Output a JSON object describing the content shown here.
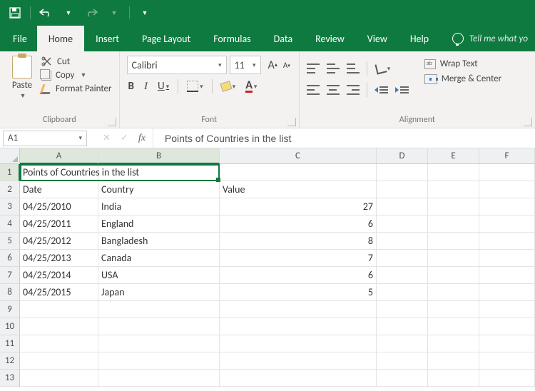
{
  "titlebar": {
    "save": "save-icon",
    "undo": "undo-icon",
    "redo": "redo-icon"
  },
  "tabs": {
    "file": "File",
    "items": [
      "Home",
      "Insert",
      "Page Layout",
      "Formulas",
      "Data",
      "Review",
      "View",
      "Help"
    ],
    "active_index": 0,
    "tell_me": "Tell me what yo"
  },
  "ribbon": {
    "clipboard": {
      "paste": "Paste",
      "cut": "Cut",
      "copy": "Copy",
      "format_painter": "Format Painter",
      "group_label": "Clipboard"
    },
    "font": {
      "name": "Calibri",
      "size": "11",
      "increase": "A",
      "decrease": "A",
      "bold": "B",
      "italic": "I",
      "underline": "U",
      "fontcolor_letter": "A",
      "group_label": "Font"
    },
    "alignment": {
      "wrap": "Wrap Text",
      "merge": "Merge & Center",
      "group_label": "Alignment"
    }
  },
  "fxbar": {
    "name_box": "A1",
    "cancel": "✕",
    "enter": "✓",
    "fx": "fx",
    "formula": "Points of Countries in the list"
  },
  "grid": {
    "columns": [
      "A",
      "B",
      "C",
      "D",
      "E",
      "F"
    ],
    "rows": [
      "1",
      "2",
      "3",
      "4",
      "5",
      "6",
      "7",
      "8",
      "9",
      "10",
      "11",
      "12",
      "13"
    ],
    "selection": {
      "col": "A",
      "row": "1"
    },
    "data": {
      "r1": {
        "A": "Points of Countries in the list"
      },
      "r2": {
        "A": "Date",
        "B": "Country",
        "C": "Value"
      },
      "r3": {
        "A": "04/25/2010",
        "B": "India",
        "C": "27"
      },
      "r4": {
        "A": "04/25/2011",
        "B": "England",
        "C": "6"
      },
      "r5": {
        "A": "04/25/2012",
        "B": "Bangladesh",
        "C": "8"
      },
      "r6": {
        "A": "04/25/2013",
        "B": "Canada",
        "C": "7"
      },
      "r7": {
        "A": "04/25/2014",
        "B": "USA",
        "C": "6"
      },
      "r8": {
        "A": "04/25/2015",
        "B": "Japan",
        "C": "5"
      }
    }
  }
}
